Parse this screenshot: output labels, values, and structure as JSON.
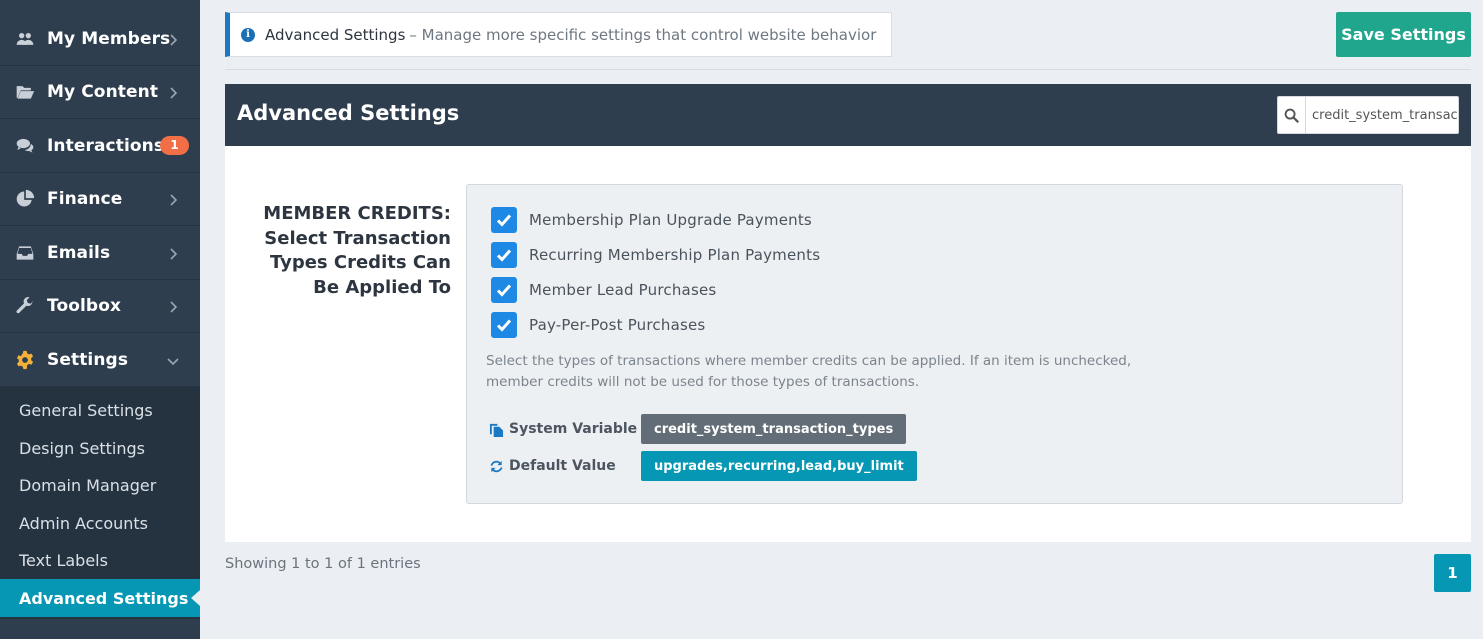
{
  "sidebar": {
    "items": [
      {
        "label": "My Members",
        "icon": "users-icon"
      },
      {
        "label": "My Content",
        "icon": "folder-open-icon"
      },
      {
        "label": "Interactions",
        "icon": "comments-icon",
        "badge": "1"
      },
      {
        "label": "Finance",
        "icon": "pie-chart-icon"
      },
      {
        "label": "Emails",
        "icon": "inbox-icon"
      },
      {
        "label": "Toolbox",
        "icon": "wrench-icon"
      },
      {
        "label": "Settings",
        "icon": "gear-icon",
        "expanded": true
      }
    ],
    "submenu": [
      {
        "label": "General Settings"
      },
      {
        "label": "Design Settings"
      },
      {
        "label": "Domain Manager"
      },
      {
        "label": "Admin Accounts"
      },
      {
        "label": "Text Labels"
      },
      {
        "label": "Advanced Settings",
        "active": true
      }
    ]
  },
  "notice": {
    "title": "Advanced Settings",
    "description": "– Manage more specific settings that control website behavior"
  },
  "toolbar": {
    "save_label": "Save Settings"
  },
  "panel": {
    "title": "Advanced Settings",
    "search_value": "credit_system_transaction_types"
  },
  "setting": {
    "label": "MEMBER CREDITS: Select Transaction Types Credits Can Be Applied To",
    "options": [
      {
        "label": "Membership Plan Upgrade Payments",
        "checked": true
      },
      {
        "label": "Recurring Membership Plan Payments",
        "checked": true
      },
      {
        "label": "Member Lead Purchases",
        "checked": true
      },
      {
        "label": "Pay-Per-Post Purchases",
        "checked": true
      }
    ],
    "help_text": "Select the types of transactions where member credits can be applied. If an item is unchecked, member credits will not be used for those types of transactions.",
    "system_variable_label": "System Variable",
    "system_variable_value": "credit_system_transaction_types",
    "default_value_label": "Default Value",
    "default_value": "upgrades,recurring,lead,buy_limit"
  },
  "pagination": {
    "showing": "Showing 1 to 1 of 1 entries",
    "current_page": "1"
  },
  "colors": {
    "sidebar_bg": "#2f3e4e",
    "accent_teal": "#0597b3",
    "save_green": "#1fa68c",
    "checkbox_blue": "#1e88e5",
    "badge_orange": "#f26e46"
  }
}
